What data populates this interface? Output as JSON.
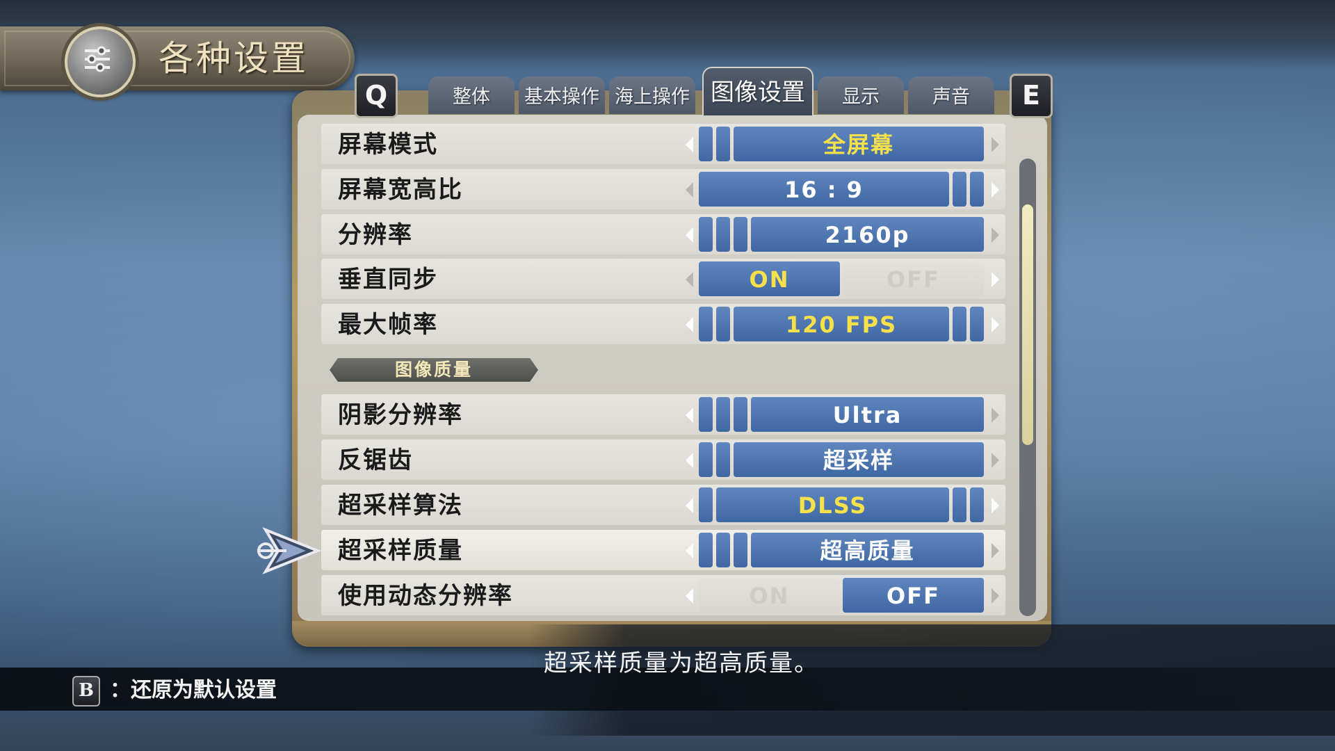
{
  "title": "各种设置",
  "nav": {
    "prev_key": "Q",
    "next_key": "E"
  },
  "tabs": [
    {
      "label": "整体",
      "active": false
    },
    {
      "label": "基本操作",
      "active": false
    },
    {
      "label": "海上操作",
      "active": false
    },
    {
      "label": "图像设置",
      "active": true
    },
    {
      "label": "显示",
      "active": false
    },
    {
      "label": "声音",
      "active": false
    }
  ],
  "settings": {
    "screen_mode": {
      "label": "屏幕模式",
      "value": "全屏幕"
    },
    "aspect_ratio": {
      "label": "屏幕宽高比",
      "value": "16 : 9"
    },
    "resolution": {
      "label": "分辨率",
      "value": "2160p"
    },
    "vsync": {
      "label": "垂直同步",
      "on": "ON",
      "off": "OFF",
      "selected": "ON"
    },
    "max_fps": {
      "label": "最大帧率",
      "value": "120 FPS"
    },
    "section_quality": "图像质量",
    "shadow_resolution": {
      "label": "阴影分辨率",
      "value": "Ultra"
    },
    "antialiasing": {
      "label": "反锯齿",
      "value": "超采样"
    },
    "upscale_algorithm": {
      "label": "超采样算法",
      "value": "DLSS"
    },
    "upscale_quality": {
      "label": "超采样质量",
      "value": "超高质量"
    },
    "dynamic_resolution": {
      "label": "使用动态分辨率",
      "on": "ON",
      "off": "OFF",
      "selected": "OFF"
    }
  },
  "description": "超采样质量为超高质量。",
  "footer": {
    "key": "B",
    "text": "：还原为默认设置"
  },
  "colors": {
    "value_blue": "#4a72ad",
    "value_yellow": "#f7e14a",
    "row_bg": "#e2e0da",
    "tab_bg": "#5a6474"
  }
}
